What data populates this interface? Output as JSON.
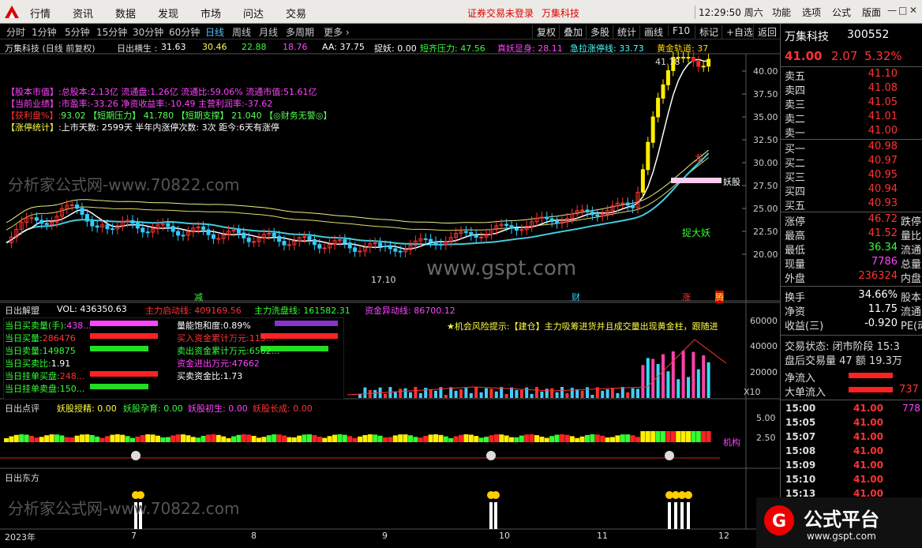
{
  "app": {
    "menu": [
      "行情",
      "资讯",
      "数据",
      "发现",
      "市场",
      "问达",
      "交易"
    ],
    "warning": "证券交易未登录",
    "stock_tag": "万集科技",
    "clock": "12:29:50 周六",
    "right_menu": [
      "功能",
      "选项",
      "公式",
      "版面"
    ],
    "win_controls": [
      "—",
      "□",
      "✕"
    ]
  },
  "toolbar": {
    "periods": [
      "分时",
      "1分钟",
      "5分钟",
      "15分钟",
      "30分钟",
      "60分钟",
      "日线",
      "周线",
      "月线",
      "多周期",
      "更多 ›"
    ],
    "active": "日线",
    "tools": [
      "复权",
      "叠加",
      "多股",
      "统计",
      "画线",
      "F10",
      "标记",
      "+自选",
      "返回"
    ]
  },
  "main": {
    "title": "万集科技 (日线 前复权)",
    "ind_label": "日出横生 :",
    "ind_vals": [
      "31.63",
      "30.46",
      "22.88",
      "18.76"
    ],
    "aa": "AA: 37.75",
    "zy": "捉妖: 0.00",
    "dq": "短齐压力: 47.56",
    "zyxs": "真妖显身: 28.11",
    "jl": "急拉涨停线: 33.73",
    "hj": "黄金轨道: 37",
    "info": [
      {
        "k": "【股本市值】:",
        "v": "总股本:2.13亿 流通盘:1.26亿 流通比:59.06% 流通市值:51.61亿",
        "kc": "#ff44ff",
        "vc": "#ff44ff"
      },
      {
        "k": "【当前业绩】:",
        "v": "市盈率:-33.26 净资收益率:-10.49 主营利润率:-37.62",
        "kc": "#ff44ff",
        "vc": "#ff44ff"
      },
      {
        "k": "【获利盘%】:",
        "v": "93.02 【短期压力】 41.780 【短期支撑】 21.040 【◎财务无警◎】",
        "kc": "#ff3333",
        "vc": "#55ff55"
      },
      {
        "k": "【涨停统计】:",
        "v": "上市天数: 2599天 半年内涨停次数: 3次  距今:6天有涨停",
        "kc": "#ffff44",
        "vc": "#ffffff"
      }
    ],
    "price_axis": [
      "40.00",
      "37.50",
      "35.00",
      "32.50",
      "30.00",
      "27.50",
      "25.00",
      "22.50",
      "20.00"
    ],
    "high_label": "41.78",
    "low_label": "17.10",
    "yao": "妖股",
    "long": "龙",
    "zdy": "捉大妖",
    "evt": [
      "减",
      "财",
      "涨",
      "腾"
    ],
    "watermark": "分析家公式网-www.70822.com",
    "gspt": "www.gspt.com"
  },
  "vol": {
    "title": "日出解盟",
    "vol": "VOL: 436350.63",
    "zq": "主力启动线: 409169.56",
    "zx": "主力洗盘线: 161582.31",
    "zy": "资金异动线: 86700.12",
    "left": [
      {
        "k": "当日买卖量(手):",
        "v": "438...",
        "c": "#ff44ff"
      },
      {
        "k": "当日买量:",
        "v": "286476",
        "c": "#ff3333"
      },
      {
        "k": "当日卖量:",
        "v": "149875",
        "c": "#33ff33"
      },
      {
        "k": "当日买卖比:",
        "v": "1.91",
        "c": "#fff"
      },
      {
        "k": "当日挂单买盘:",
        "v": "248...",
        "c": "#ff3333"
      },
      {
        "k": "当日挂单卖盘:",
        "v": "150...",
        "c": "#33ff33"
      }
    ],
    "mid": [
      {
        "k": "量能饱和度:",
        "v": "0.89%",
        "c": "#fff"
      },
      {
        "k": "买入资金累计万元:",
        "v": "113...",
        "c": "#ff3333"
      },
      {
        "k": "卖出资金累计万元:",
        "v": "6562...",
        "c": "#33ff33"
      },
      {
        "k": "资金进出万元:",
        "v": "47662",
        "c": "#ff44ff"
      },
      {
        "k": "买卖资金比:",
        "v": "1.73",
        "c": "#fff"
      }
    ],
    "alert": "★机会风险提示:【建仓】主力吸筹进货并且成交量出现黄金柱，跟随进",
    "axis": [
      "60000",
      "40000",
      "20000",
      "X10"
    ]
  },
  "p3": {
    "title": "日出点评",
    "items": [
      {
        "t": "妖股授精: 0.00",
        "c": "#ffff44"
      },
      {
        "t": "妖股孕育: 0.00",
        "c": "#33ff33"
      },
      {
        "t": "妖股初生: 0.00",
        "c": "#ff44ff"
      },
      {
        "t": "妖股长成: 0.00",
        "c": "#ff3333"
      }
    ],
    "axis": [
      "5.00",
      "2.50"
    ],
    "tag": "机构"
  },
  "p4": {
    "title": "日出东方"
  },
  "xaxis": [
    "2023年",
    "7",
    "8",
    "9",
    "10",
    "11",
    "12"
  ],
  "right": {
    "name": "万集科技",
    "code": "300552",
    "price": "41.00",
    "chg": "2.07",
    "pct": "5.32%",
    "sells": [
      {
        "k": "卖五",
        "v": "41.10"
      },
      {
        "k": "卖四",
        "v": "41.08"
      },
      {
        "k": "卖三",
        "v": "41.05"
      },
      {
        "k": "卖二",
        "v": "41.01"
      },
      {
        "k": "卖一",
        "v": "41.00"
      }
    ],
    "buys": [
      {
        "k": "买一",
        "v": "40.98"
      },
      {
        "k": "买二",
        "v": "40.97"
      },
      {
        "k": "买三",
        "v": "40.95"
      },
      {
        "k": "买四",
        "v": "40.94"
      },
      {
        "k": "买五",
        "v": "40.93"
      }
    ],
    "stats": [
      {
        "k": "涨停",
        "v": "46.72",
        "c": "#ff3333",
        "k2": "跌停"
      },
      {
        "k": "最高",
        "v": "41.52",
        "c": "#ff3333",
        "k2": "量比"
      },
      {
        "k": "最低",
        "v": "36.34",
        "c": "#33ff33",
        "k2": "流通"
      },
      {
        "k": "现量",
        "v": "7786",
        "c": "#ff44ff",
        "k2": "总量"
      },
      {
        "k": "外盘",
        "v": "236324",
        "c": "#ff3333",
        "k2": "内盘"
      }
    ],
    "stats2": [
      {
        "k": "换手",
        "v": "34.66%",
        "c": "#fff",
        "k2": "股本"
      },
      {
        "k": "净资",
        "v": "11.75",
        "c": "#fff",
        "k2": "流通"
      },
      {
        "k": "收益(三)",
        "v": "-0.920",
        "c": "#fff",
        "k2": "PE(动)"
      }
    ],
    "state": "交易状态: 闭市阶段 15:3",
    "after": "盘后交易量 47 额 19.3万",
    "jl": "净流入",
    "dd": "大单流入",
    "ddv": "737",
    "ticks": [
      {
        "t": "15:00",
        "p": "41.00",
        "v": "778"
      },
      {
        "t": "15:05",
        "p": "41.00",
        "v": ""
      },
      {
        "t": "15:07",
        "p": "41.00",
        "v": ""
      },
      {
        "t": "15:08",
        "p": "41.00",
        "v": ""
      },
      {
        "t": "15:09",
        "p": "41.00",
        "v": ""
      },
      {
        "t": "15:10",
        "p": "41.00",
        "v": ""
      },
      {
        "t": "15:13",
        "p": "41.00",
        "v": ""
      }
    ]
  },
  "badge": {
    "text": "公式平台",
    "url": "www.gspt.com"
  }
}
